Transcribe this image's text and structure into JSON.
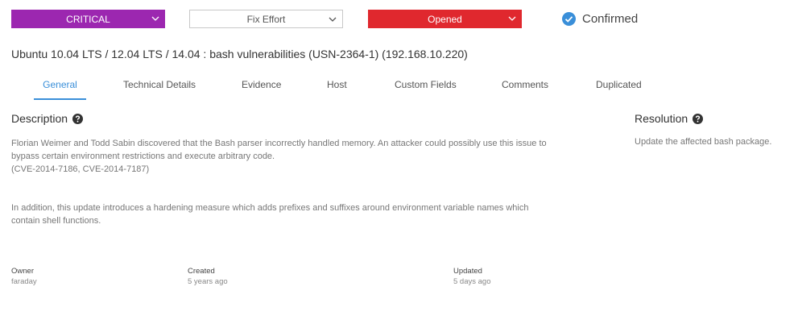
{
  "toolbar": {
    "severity": "CRITICAL",
    "effort": "Fix Effort",
    "status": "Opened",
    "confirmed": "Confirmed"
  },
  "vuln_title": "Ubuntu 10.04 LTS / 12.04 LTS / 14.04 : bash vulnerabilities (USN-2364-1) (192.168.10.220)",
  "tabs": [
    {
      "label": "General",
      "active": true
    },
    {
      "label": "Technical Details"
    },
    {
      "label": "Evidence"
    },
    {
      "label": "Host"
    },
    {
      "label": "Custom Fields"
    },
    {
      "label": "Comments"
    },
    {
      "label": "Duplicated"
    }
  ],
  "description": {
    "heading": "Description",
    "line1": "Florian Weimer and Todd Sabin discovered that the Bash parser incorrectly handled memory. An attacker could possibly use this issue to",
    "line2": "bypass certain environment restrictions and execute arbitrary code.",
    "line3": "(CVE-2014-7186, CVE-2014-7187)",
    "line4": "In addition, this update introduces a hardening measure which adds prefixes and suffixes around environment variable names which",
    "line5": "contain shell functions."
  },
  "resolution": {
    "heading": "Resolution",
    "text": "Update the affected bash package."
  },
  "meta": {
    "owner_label": "Owner",
    "owner_value": "faraday",
    "created_label": "Created",
    "created_value": "5 years ago",
    "updated_label": "Updated",
    "updated_value": "5 days ago"
  },
  "colors": {
    "severity": "#9c27b0",
    "status": "#e0282e",
    "accent": "#3a8fd9"
  }
}
